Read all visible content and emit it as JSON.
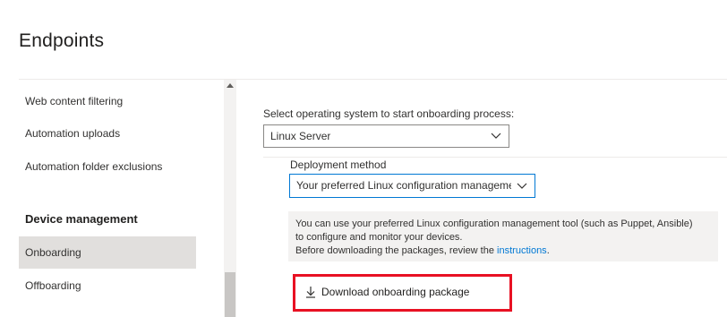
{
  "header": {
    "title": "Endpoints"
  },
  "sidebar": {
    "items": [
      {
        "label": "Web content filtering"
      },
      {
        "label": "Automation uploads"
      },
      {
        "label": "Automation folder exclusions"
      }
    ],
    "section_heading": "Device management",
    "section_items": [
      {
        "label": "Onboarding",
        "selected": true
      },
      {
        "label": "Offboarding",
        "selected": false
      }
    ]
  },
  "main": {
    "os_prompt": "Select operating system to start onboarding process:",
    "os_selected": "Linux Server",
    "deployment_label": "Deployment method",
    "deployment_selected": "Your preferred Linux configuration manageme...",
    "info_line1": "You can use your preferred Linux configuration management tool (such as Puppet, Ansible)",
    "info_line2": "to configure and monitor your devices.",
    "info_line3_prefix": "Before downloading the packages, review the ",
    "info_link": "instructions",
    "info_line3_suffix": ".",
    "download_label": "Download onboarding package"
  },
  "icons": {
    "chevron": "chevron-down-icon",
    "download": "download-icon",
    "scroll_up": "scroll-up-icon"
  },
  "colors": {
    "accent": "#0078d4",
    "highlight": "#e81123",
    "selected_bg": "#e1dfdd",
    "info_bg": "#f3f2f1"
  }
}
